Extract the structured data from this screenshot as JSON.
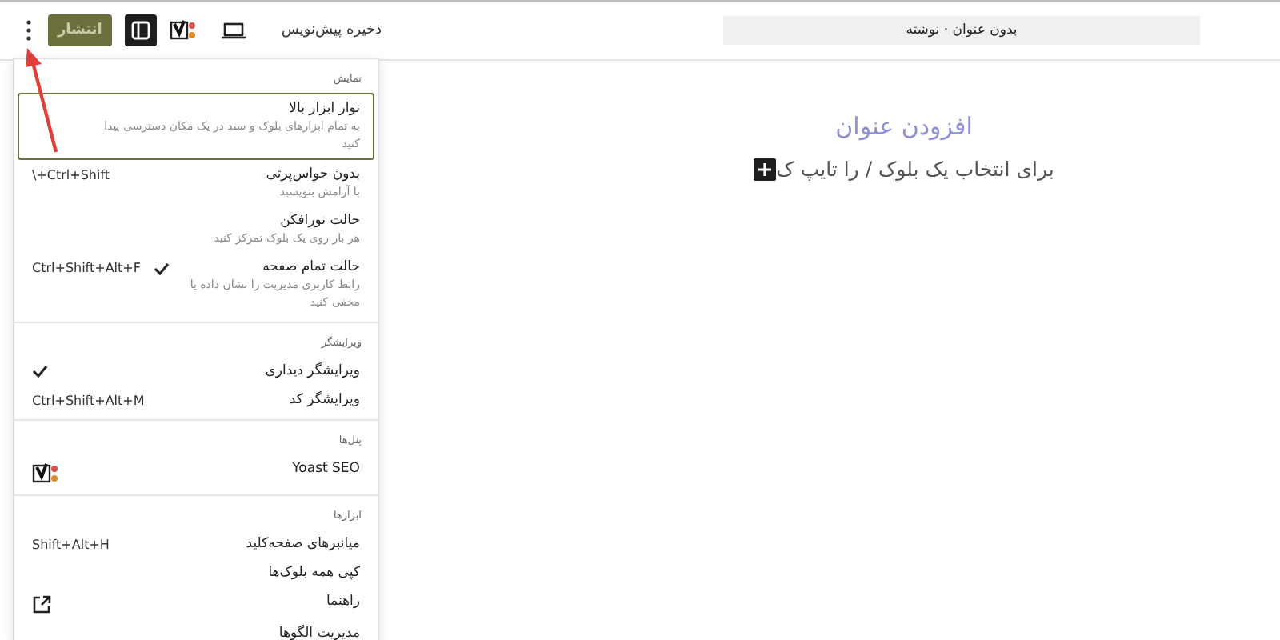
{
  "toolbar": {
    "publish": "انتشار",
    "save_draft": "ذخیره پیش‌نویس",
    "document_title": "بدون عنوان · نوشته"
  },
  "editor": {
    "title_placeholder": "افزودن عنوان",
    "block_prompt": "برای انتخاب یک بلوک / را تایپ ک"
  },
  "menu": {
    "sections": [
      {
        "label": "نمایش",
        "items": [
          {
            "title": "نوار ابزار بالا",
            "description": "به تمام ابزارهای بلوک و سند در یک مکان دسترسی پیدا کنید",
            "checked": false,
            "focused": true
          },
          {
            "title": "بدون حواس‌پرتی",
            "description": "با آرامش بنویسید",
            "shortcut": "\\+Ctrl+Shift",
            "checked": false,
            "focused": false
          },
          {
            "title": "حالت نورافکن",
            "description": "هر بار روی یک بلوک تمرکز کنید",
            "checked": false,
            "focused": false
          },
          {
            "title": "حالت تمام صفحه",
            "description": "رابط کاربری مدیریت را نشان داده یا مخفی کنید",
            "shortcut": "Ctrl+Shift+Alt+F",
            "checked": true,
            "focused": false
          }
        ]
      },
      {
        "label": "ویرایشگر",
        "items": [
          {
            "title": "ویرایشگر دیداری",
            "checked": true,
            "focused": false
          },
          {
            "title": "ویرایشگر کد",
            "shortcut": "Ctrl+Shift+Alt+M",
            "checked": false,
            "focused": false
          }
        ]
      },
      {
        "label": "پنل‌ها",
        "items": [
          {
            "title": "Yoast SEO",
            "kind": "yoast",
            "checked": false,
            "focused": false
          }
        ]
      },
      {
        "label": "ابزارها",
        "items": [
          {
            "title": "میانبرهای صفحه‌کلید",
            "shortcut": "Shift+Alt+H",
            "checked": false,
            "focused": false
          },
          {
            "title": "کپی همه بلوک‌ها",
            "checked": false,
            "focused": false
          },
          {
            "title": "راهنما",
            "kind": "external",
            "checked": false,
            "focused": false
          },
          {
            "title": "مدیریت الگوها",
            "checked": false,
            "focused": false
          }
        ]
      }
    ]
  }
}
